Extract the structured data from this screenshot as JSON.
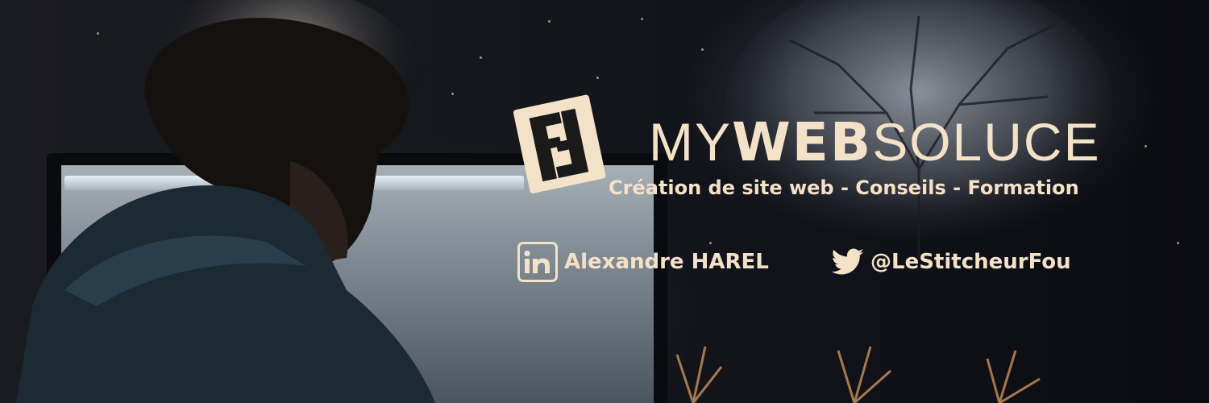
{
  "brand": {
    "name_part1": "MY",
    "name_part2": "WEB",
    "name_part3": "SOLUCE",
    "tagline": "Création de site web - Conseils - Formation",
    "accent_color": "#f4e2c8"
  },
  "social": {
    "linkedin": {
      "icon": "linkedin-icon",
      "label": "Alexandre HAREL"
    },
    "twitter": {
      "icon": "twitter-bird-icon",
      "label": "@LeStitcheurFou"
    }
  },
  "logo": {
    "icon": "mywebsoluce-logo-icon"
  }
}
